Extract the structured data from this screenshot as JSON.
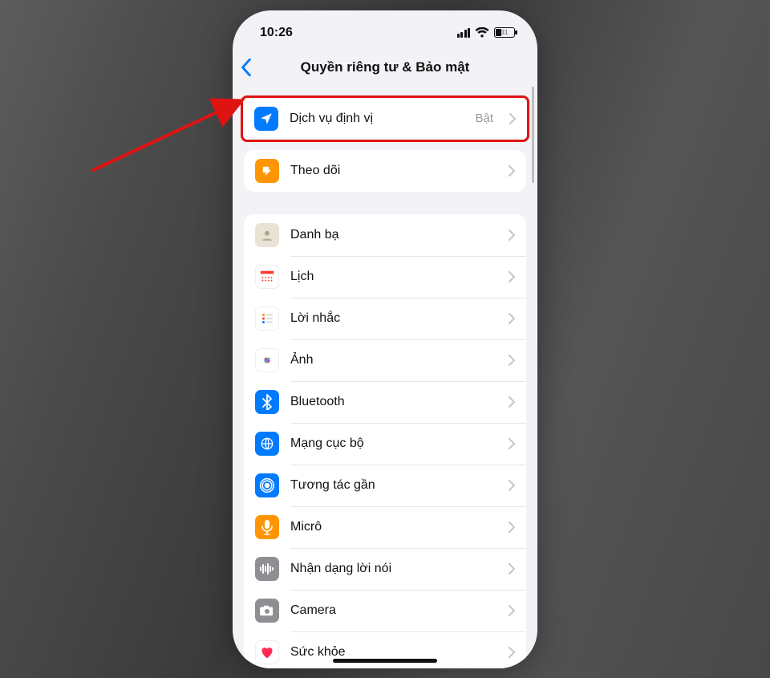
{
  "status": {
    "time": "10:26",
    "battery_pct": "31"
  },
  "header": {
    "title": "Quyền riêng tư & Bảo mật"
  },
  "rows": {
    "location": {
      "label": "Dịch vụ định vị",
      "value": "Bật",
      "icon": "location-arrow",
      "bg": "#007aff"
    },
    "tracking": {
      "label": "Theo dõi",
      "icon": "hand-app",
      "bg": "#ff9500"
    },
    "contacts": {
      "label": "Danh bạ",
      "icon": "contacts",
      "bg": "#ded9cd"
    },
    "calendar": {
      "label": "Lịch",
      "icon": "calendar",
      "bg": "#ffffff"
    },
    "reminders": {
      "label": "Lời nhắc",
      "icon": "reminders",
      "bg": "#ffffff"
    },
    "photos": {
      "label": "Ảnh",
      "icon": "photos",
      "bg": "#ffffff"
    },
    "bluetooth": {
      "label": "Bluetooth",
      "icon": "bluetooth",
      "bg": "#007aff"
    },
    "localnet": {
      "label": "Mạng cục bộ",
      "icon": "globe-grid",
      "bg": "#007aff"
    },
    "nearby": {
      "label": "Tương tác gần",
      "icon": "nearby",
      "bg": "#007aff"
    },
    "mic": {
      "label": "Micrô",
      "icon": "microphone",
      "bg": "#ff9500"
    },
    "speech": {
      "label": "Nhận dạng lời nói",
      "icon": "waveform",
      "bg": "#8e8e93"
    },
    "camera": {
      "label": "Camera",
      "icon": "camera",
      "bg": "#8e8e93"
    },
    "health": {
      "label": "Sức khỏe",
      "icon": "health-heart",
      "bg": "#ffffff"
    }
  },
  "colors": {
    "highlight_border": "#e01313",
    "arrow": "#e01313",
    "ios_blue": "#007aff"
  }
}
